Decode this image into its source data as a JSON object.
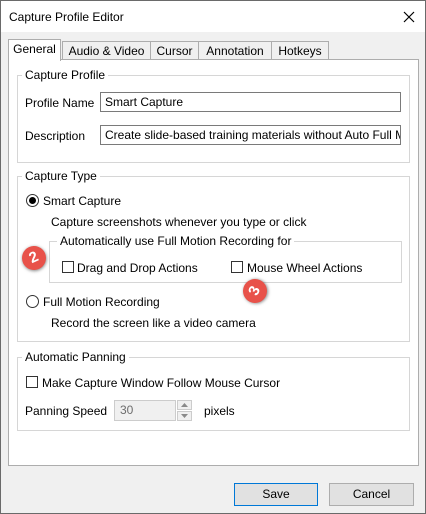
{
  "window": {
    "title": "Capture Profile Editor"
  },
  "tabs": [
    {
      "label": "General",
      "active": true
    },
    {
      "label": "Audio & Video",
      "active": false
    },
    {
      "label": "Cursor",
      "active": false
    },
    {
      "label": "Annotation",
      "active": false
    },
    {
      "label": "Hotkeys",
      "active": false
    }
  ],
  "capture_profile": {
    "legend": "Capture Profile",
    "name_label": "Profile Name",
    "name_value": "Smart Capture",
    "description_label": "Description",
    "description_value": "Create slide-based training materials without Auto Full Motion"
  },
  "capture_type": {
    "legend": "Capture Type",
    "smart_label": "Smart Capture",
    "smart_selected": true,
    "smart_desc": "Capture screenshots whenever you type or click",
    "auto_group_legend": "Automatically use Full Motion Recording for",
    "drag_drop_label": "Drag and Drop Actions",
    "drag_drop_checked": false,
    "mouse_wheel_label": "Mouse Wheel Actions",
    "mouse_wheel_checked": false,
    "full_motion_label": "Full Motion Recording",
    "full_motion_selected": false,
    "full_motion_desc": "Record the screen like a video camera"
  },
  "panning": {
    "legend": "Automatic Panning",
    "follow_label": "Make Capture Window Follow Mouse Cursor",
    "follow_checked": false,
    "speed_label": "Panning Speed",
    "speed_value": "30",
    "speed_unit": "pixels"
  },
  "annotations": {
    "badge_1": "2",
    "badge_2": "3",
    "badge_color": "#e8524a"
  },
  "footer": {
    "save_label": "Save",
    "cancel_label": "Cancel"
  },
  "icons": {
    "close": "close-icon",
    "spin_up": "chevron-up-icon",
    "spin_down": "chevron-down-icon"
  }
}
